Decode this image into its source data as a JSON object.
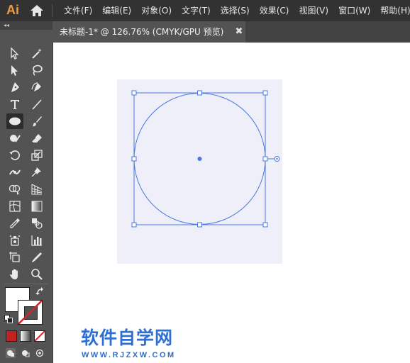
{
  "app": {
    "logo_text": "Ai"
  },
  "menu": {
    "items": [
      "文件(F)",
      "编辑(E)",
      "对象(O)",
      "文字(T)",
      "选择(S)",
      "效果(C)",
      "视图(V)",
      "窗口(W)",
      "帮助(H)"
    ]
  },
  "toolbar": {
    "collapse_label": "◂◂",
    "tools": [
      "selection-tool",
      "direct-selection-tool",
      "magic-wand-tool",
      "lasso-tool",
      "pen-tool",
      "curvature-tool",
      "type-tool",
      "line-segment-tool",
      "ellipse-tool",
      "paintbrush-tool",
      "shaper-tool",
      "eraser-tool",
      "rotate-tool",
      "scale-tool",
      "width-tool",
      "puppet-warp-tool",
      "shape-builder-tool",
      "perspective-grid-tool",
      "mesh-tool",
      "gradient-tool",
      "eyedropper-tool",
      "blend-tool",
      "symbol-sprayer-tool",
      "column-graph-tool",
      "artboard-tool",
      "slice-tool",
      "hand-tool",
      "zoom-tool"
    ],
    "active_tool": "ellipse-tool",
    "fill_color": "#ffffff",
    "stroke_color": "none"
  },
  "document": {
    "tab_title": "未标题-1* @ 126.76% (CMYK/GPU 预览)",
    "close_glyph": "✖"
  },
  "colors": {
    "menubar": "#323232",
    "toolbar": "#535353",
    "artboard": "#eeeff9",
    "selection": "#4a78e0",
    "watermark": "#2f6fd1"
  },
  "watermark": {
    "title": "软件自学网",
    "url": "WWW.RJZXW.COM"
  }
}
